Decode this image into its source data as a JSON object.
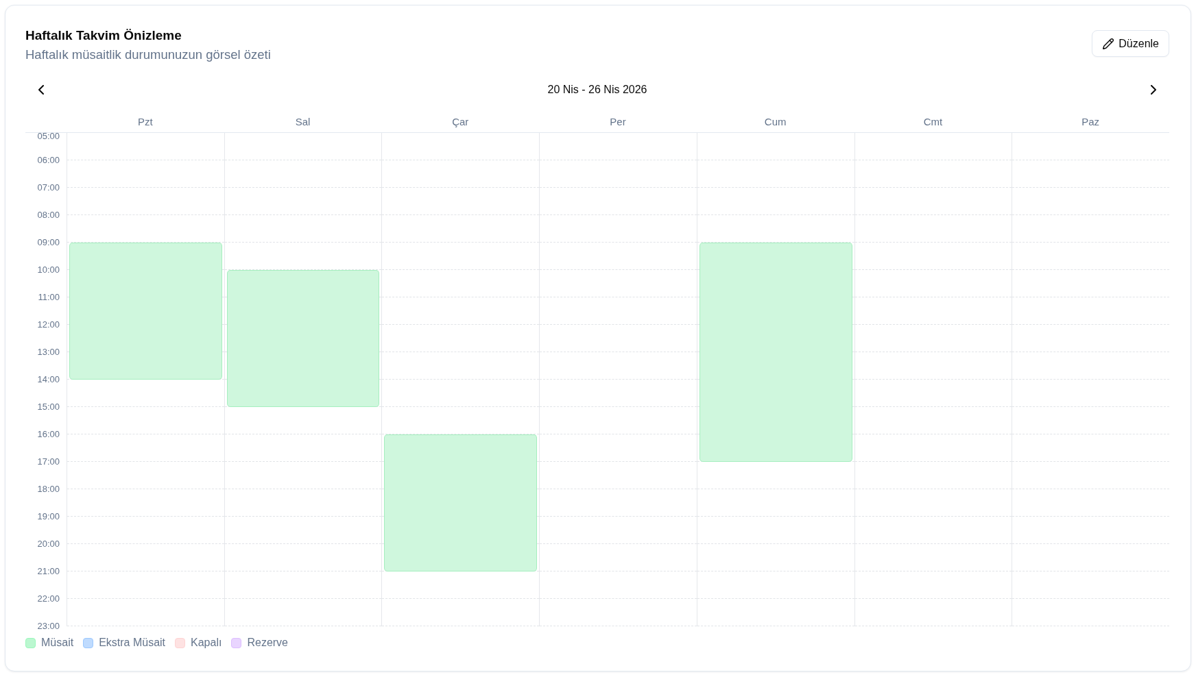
{
  "header": {
    "title": "Haftalık Takvim Önizleme",
    "subtitle": "Haftalık müsaitlik durumunuzun görsel özeti",
    "edit_button": {
      "label": "Düzenle"
    }
  },
  "week_nav": {
    "range": "20 Nis - 26 Nis 2026"
  },
  "calendar": {
    "hours": [
      "05:00",
      "06:00",
      "07:00",
      "08:00",
      "09:00",
      "10:00",
      "11:00",
      "12:00",
      "13:00",
      "14:00",
      "15:00",
      "16:00",
      "17:00",
      "18:00",
      "19:00",
      "20:00",
      "21:00",
      "22:00",
      "23:00"
    ],
    "days": [
      {
        "label": "Pzt",
        "slots": [
          {
            "available": false
          },
          {
            "available": false
          },
          {
            "available": false
          },
          {
            "available": false
          },
          {
            "available": true
          },
          {
            "available": true
          },
          {
            "available": true
          },
          {
            "available": true
          },
          {
            "available": true
          },
          {
            "available": false
          },
          {
            "available": false
          },
          {
            "available": false
          },
          {
            "available": false
          },
          {
            "available": false
          },
          {
            "available": false
          },
          {
            "available": false
          },
          {
            "available": false
          },
          {
            "available": false
          }
        ]
      },
      {
        "label": "Sal",
        "slots": [
          {
            "available": false
          },
          {
            "available": false
          },
          {
            "available": false
          },
          {
            "available": false
          },
          {
            "available": false
          },
          {
            "available": true
          },
          {
            "available": true
          },
          {
            "available": true
          },
          {
            "available": true
          },
          {
            "available": true
          },
          {
            "available": false
          },
          {
            "available": false
          },
          {
            "available": false
          },
          {
            "available": false
          },
          {
            "available": false
          },
          {
            "available": false
          },
          {
            "available": false
          },
          {
            "available": false
          }
        ]
      },
      {
        "label": "Çar",
        "slots": [
          {
            "available": false
          },
          {
            "available": false
          },
          {
            "available": false
          },
          {
            "available": false
          },
          {
            "available": false
          },
          {
            "available": false
          },
          {
            "available": false
          },
          {
            "available": false
          },
          {
            "available": false
          },
          {
            "available": false
          },
          {
            "available": false
          },
          {
            "available": true
          },
          {
            "available": true
          },
          {
            "available": true
          },
          {
            "available": true
          },
          {
            "available": true
          },
          {
            "available": false
          },
          {
            "available": false
          }
        ]
      },
      {
        "label": "Per",
        "slots": [
          {
            "available": false
          },
          {
            "available": false
          },
          {
            "available": false
          },
          {
            "available": false
          },
          {
            "available": false
          },
          {
            "available": false
          },
          {
            "available": false
          },
          {
            "available": false
          },
          {
            "available": false
          },
          {
            "available": false
          },
          {
            "available": false
          },
          {
            "available": false
          },
          {
            "available": false
          },
          {
            "available": false
          },
          {
            "available": false
          },
          {
            "available": false
          },
          {
            "available": false
          },
          {
            "available": false
          }
        ]
      },
      {
        "label": "Cum",
        "slots": [
          {
            "available": false
          },
          {
            "available": false
          },
          {
            "available": false
          },
          {
            "available": false
          },
          {
            "available": true
          },
          {
            "available": true
          },
          {
            "available": true
          },
          {
            "available": true
          },
          {
            "available": true
          },
          {
            "available": true
          },
          {
            "available": true
          },
          {
            "available": true
          },
          {
            "available": false
          },
          {
            "available": false
          },
          {
            "available": false
          },
          {
            "available": false
          },
          {
            "available": false
          },
          {
            "available": false
          }
        ]
      },
      {
        "label": "Cmt",
        "slots": [
          {
            "available": false
          },
          {
            "available": false
          },
          {
            "available": false
          },
          {
            "available": false
          },
          {
            "available": false
          },
          {
            "available": false
          },
          {
            "available": false
          },
          {
            "available": false
          },
          {
            "available": false
          },
          {
            "available": false
          },
          {
            "available": false
          },
          {
            "available": false
          },
          {
            "available": false
          },
          {
            "available": false
          },
          {
            "available": false
          },
          {
            "available": false
          },
          {
            "available": false
          },
          {
            "available": false
          }
        ]
      },
      {
        "label": "Paz",
        "slots": [
          {
            "available": false
          },
          {
            "available": false
          },
          {
            "available": false
          },
          {
            "available": false
          },
          {
            "available": false
          },
          {
            "available": false
          },
          {
            "available": false
          },
          {
            "available": false
          },
          {
            "available": false
          },
          {
            "available": false
          },
          {
            "available": false
          },
          {
            "available": false
          },
          {
            "available": false
          },
          {
            "available": false
          },
          {
            "available": false
          },
          {
            "available": false
          },
          {
            "available": false
          },
          {
            "available": false
          }
        ]
      }
    ]
  },
  "legend": [
    {
      "label": "Müsait",
      "color": "#bbf7d0"
    },
    {
      "label": "Ekstra Müsait",
      "color": "#bfdbfe"
    },
    {
      "label": "Kapalı",
      "color": "#fee2e2"
    },
    {
      "label": "Rezerve",
      "color": "#e9d5ff"
    }
  ]
}
